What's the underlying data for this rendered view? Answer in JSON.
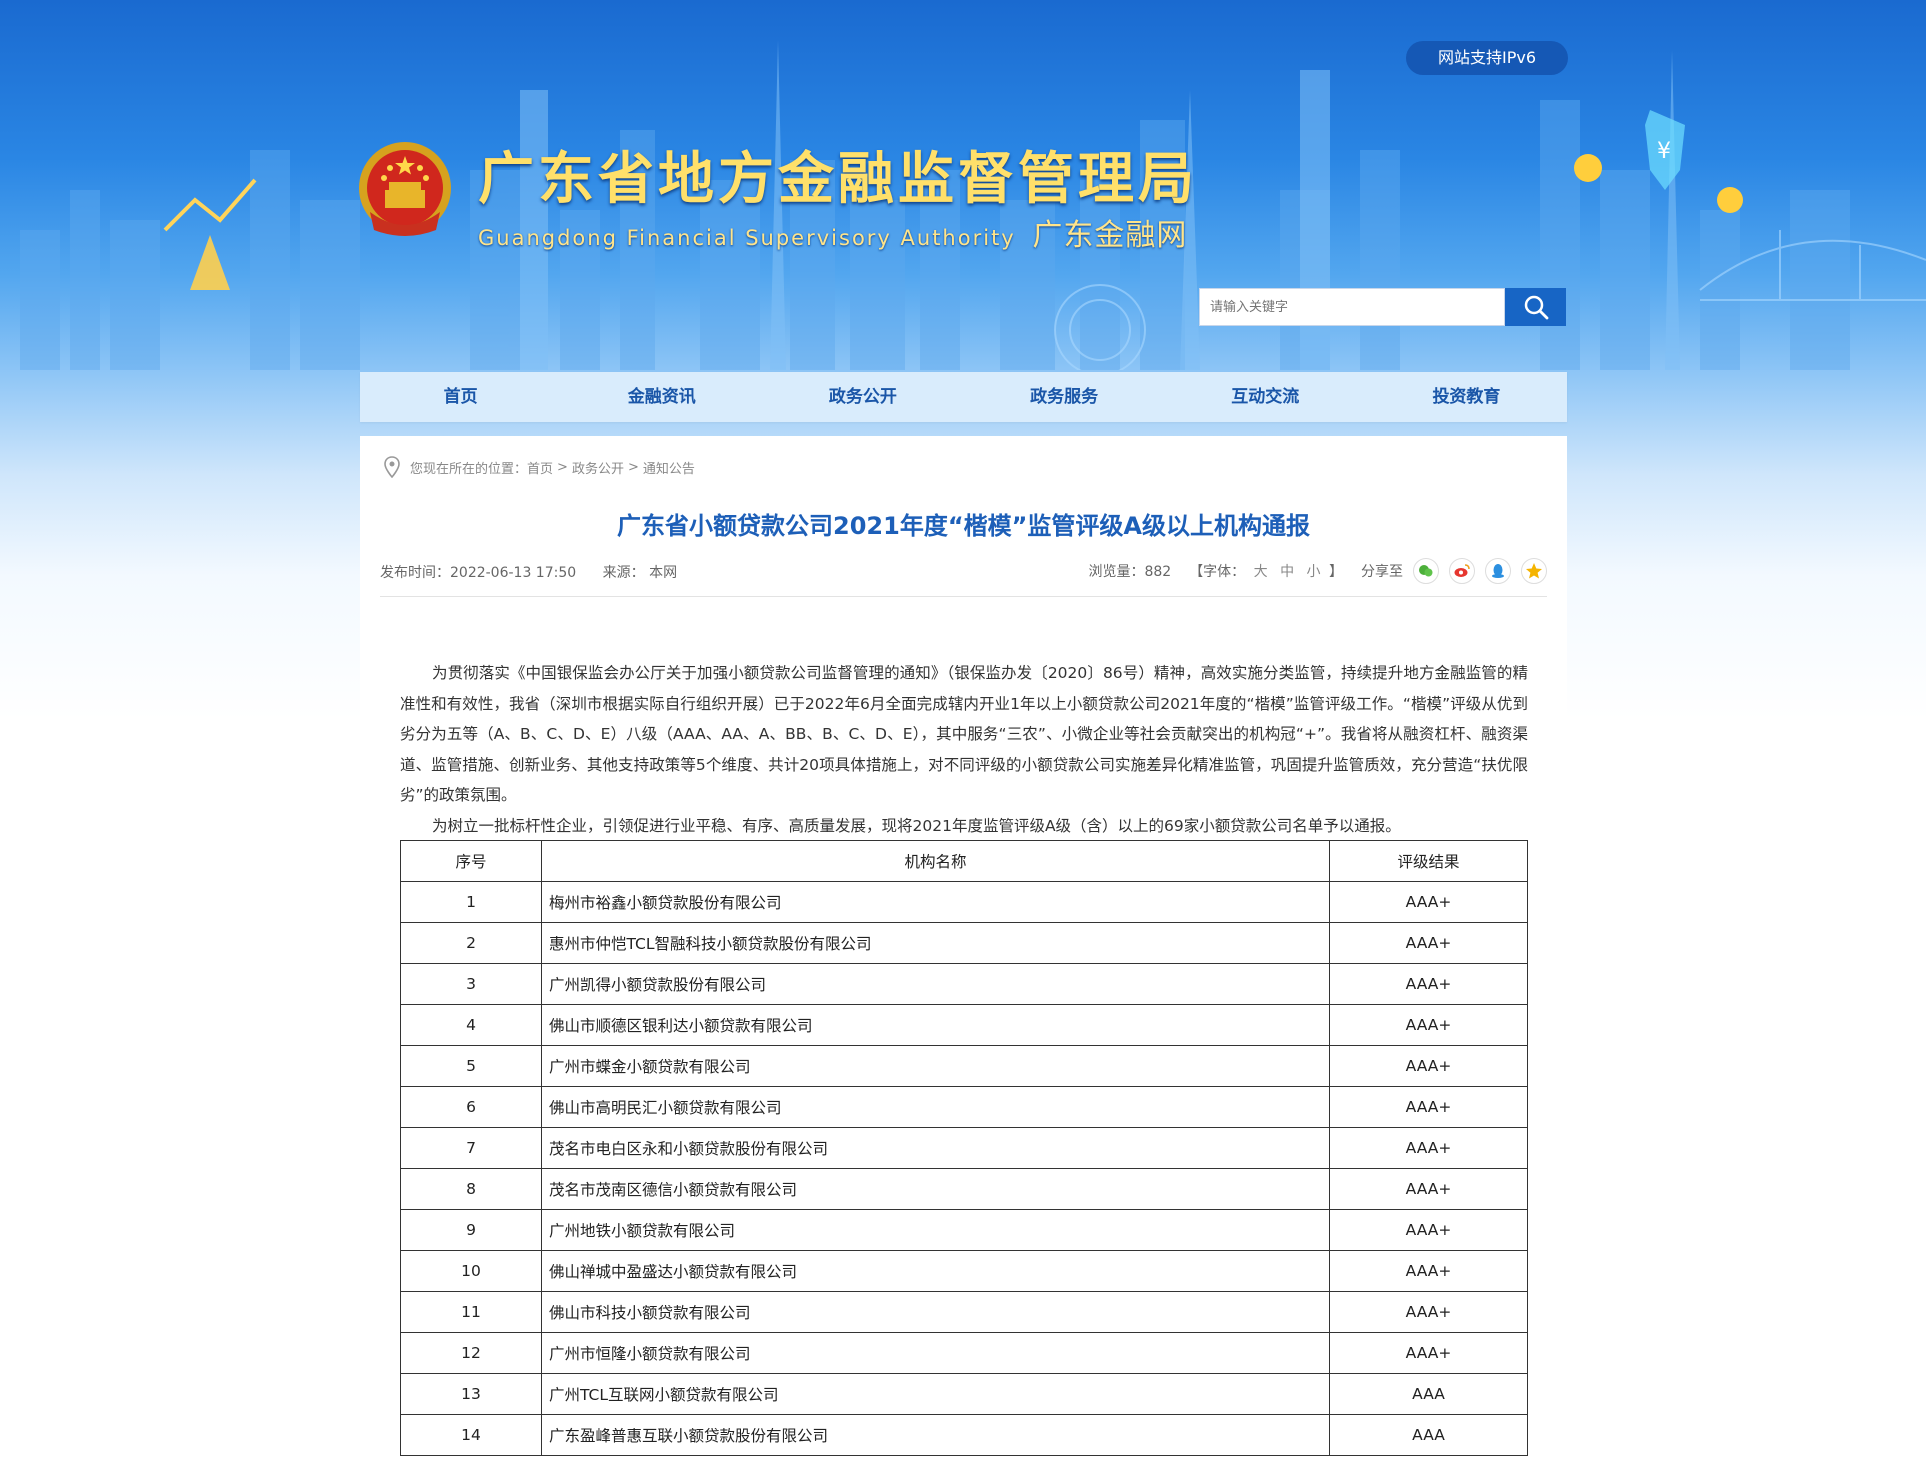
{
  "header": {
    "ipv6_label": "网站支持IPv6",
    "site_title": "广东省地方金融监督管理局",
    "site_subtitle_en": "Guangdong Financial Supervisory Authority",
    "site_subtitle_cn": "广东金融网",
    "search_placeholder": "请输入关键字"
  },
  "nav": {
    "items": [
      "首页",
      "金融资讯",
      "政务公开",
      "政务服务",
      "互动交流",
      "投资教育"
    ]
  },
  "breadcrumb": {
    "prefix": "您现在所在的位置：",
    "items": [
      "首页",
      "政务公开",
      "通知公告"
    ],
    "separator": ">"
  },
  "article": {
    "title": "广东省小额贷款公司2021年度“楷模”监管评级A级以上机构通报",
    "publish_time": "发布时间：2022-06-13 17:50",
    "source": "来源： 本网",
    "views": "浏览量：882",
    "font_size_label": "【字体：",
    "font_sizes": [
      "大",
      "中",
      "小"
    ],
    "font_size_close": "】",
    "share_label": "分享至",
    "share_icons": [
      "wechat-icon",
      "weibo-icon",
      "qq-icon",
      "qzone-icon"
    ],
    "paragraph_1": "为贯彻落实《中国银保监会办公厅关于加强小额贷款公司监督管理的通知》（银保监办发〔2020〕86号）精神，高效实施分类监管，持续提升地方金融监管的精准性和有效性，我省（深圳市根据实际自行组织开展）已于2022年6月全面完成辖内开业1年以上小额贷款公司2021年度的“楷模”监管评级工作。“楷模”评级从优到劣分为五等（A、B、C、D、E）八级（AAA、AA、A、BB、B、C、D、E），其中服务“三农”、小微企业等社会贡献突出的机构冠“+”。我省将从融资杠杆、融资渠道、监管措施、创新业务、其他支持政策等5个维度、共计20项具体措施上，对不同评级的小额贷款公司实施差异化精准监管，巩固提升监管质效，充分营造“扶优限劣”的政策氛围。",
    "paragraph_2": "为树立一批标杆性企业，引领促进行业平稳、有序、高质量发展，现将2021年度监管评级A级（含）以上的69家小额贷款公司名单予以通报。"
  },
  "table": {
    "headers": [
      "序号",
      "机构名称",
      "评级结果"
    ],
    "rows": [
      [
        "1",
        "梅州市裕鑫小额贷款股份有限公司",
        "AAA+"
      ],
      [
        "2",
        "惠州市仲恺TCL智融科技小额贷款股份有限公司",
        "AAA+"
      ],
      [
        "3",
        "广州凯得小额贷款股份有限公司",
        "AAA+"
      ],
      [
        "4",
        "佛山市顺德区银利达小额贷款有限公司",
        "AAA+"
      ],
      [
        "5",
        "广州市蝶金小额贷款有限公司",
        "AAA+"
      ],
      [
        "6",
        "佛山市高明民汇小额贷款有限公司",
        "AAA+"
      ],
      [
        "7",
        "茂名市电白区永和小额贷款股份有限公司",
        "AAA+"
      ],
      [
        "8",
        "茂名市茂南区德信小额贷款有限公司",
        "AAA+"
      ],
      [
        "9",
        "广州地铁小额贷款有限公司",
        "AAA+"
      ],
      [
        "10",
        "佛山禅城中盈盛达小额贷款有限公司",
        "AAA+"
      ],
      [
        "11",
        "佛山市科技小额贷款有限公司",
        "AAA+"
      ],
      [
        "12",
        "广州市恒隆小额贷款有限公司",
        "AAA+"
      ],
      [
        "13",
        "广州TCL互联网小额贷款有限公司",
        "AAA"
      ],
      [
        "14",
        "广东盈峰普惠互联小额贷款股份有限公司",
        "AAA"
      ]
    ]
  },
  "colors": {
    "banner_top": "#1a6ad0",
    "title_gold": "#ffe06a",
    "nav_bg": "#d9ecfc",
    "nav_text": "#1a56a8",
    "article_title": "#1d5fb8",
    "search_button": "#1765c5"
  }
}
